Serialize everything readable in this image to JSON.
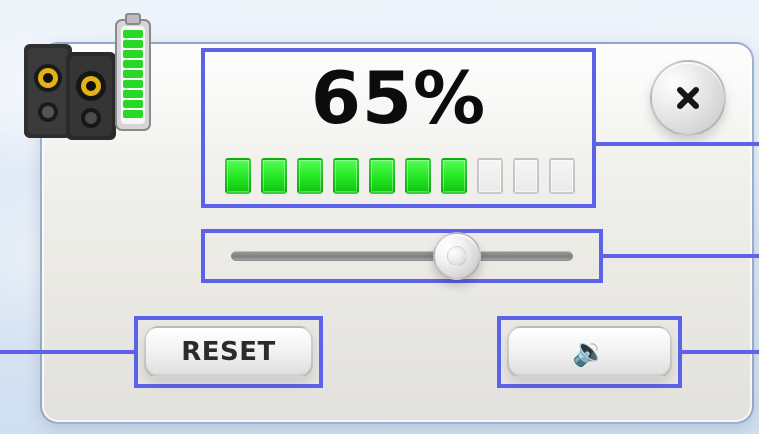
{
  "window": {
    "background_color": "#dfe9f5",
    "panel_border_color": "#5c63e8"
  },
  "volume": {
    "percent_text": "65%",
    "percent_value": 65,
    "segments_total": 10,
    "segments_on": 7
  },
  "buttons": {
    "close_icon": "close-icon",
    "reset_label": "RESET",
    "mute_icon": "speaker-icon",
    "mute_glyph": "🔉"
  },
  "icons": {
    "app_icon": "speakers-battery-icon"
  },
  "colors": {
    "accent_outline": "#5c63e8",
    "level_on": "#24e624",
    "level_off": "#e9e9e9"
  }
}
